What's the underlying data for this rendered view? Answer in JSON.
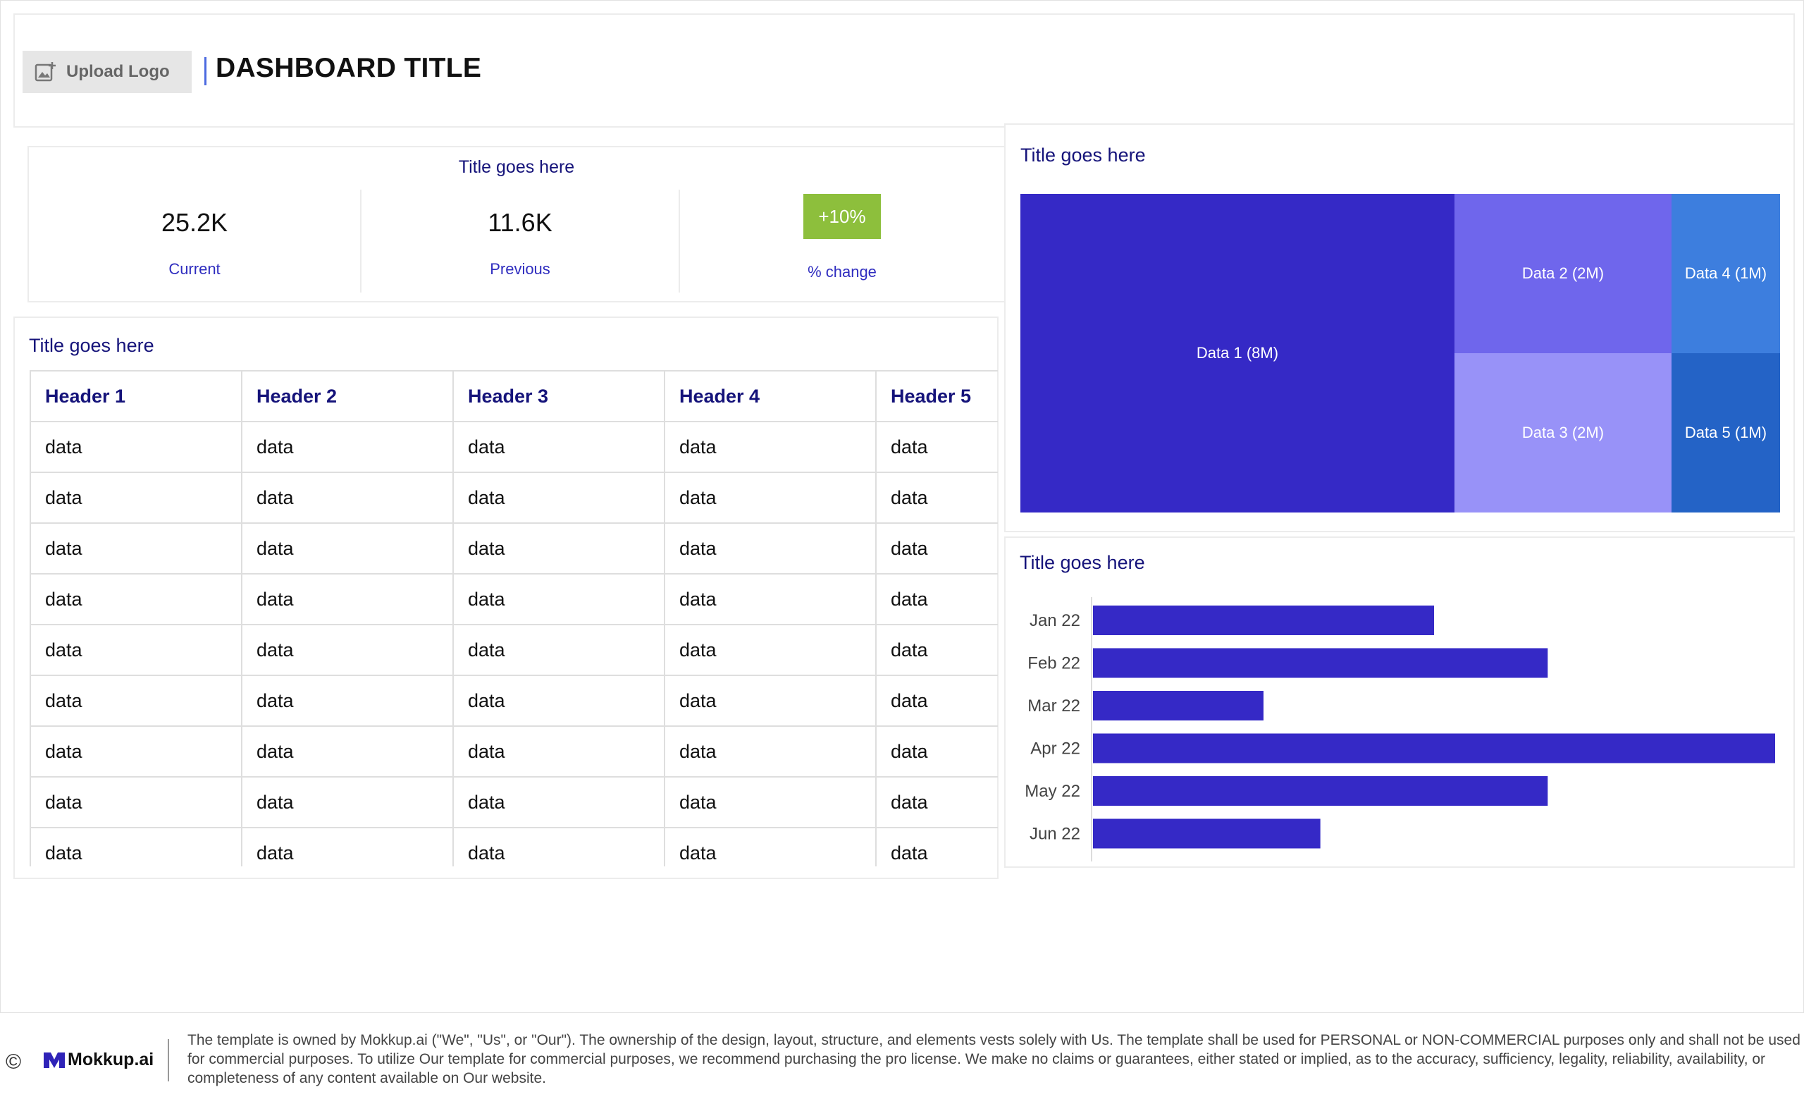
{
  "header": {
    "upload_logo_label": "Upload Logo",
    "title": "DASHBOARD TITLE"
  },
  "kpi": {
    "title": "Title goes here",
    "current": {
      "value": "25.2K",
      "label": "Current"
    },
    "previous": {
      "value": "11.6K",
      "label": "Previous"
    },
    "change": {
      "value": "+10%",
      "label": "% change"
    }
  },
  "table": {
    "title": "Title goes here",
    "headers": [
      "Header 1",
      "Header 2",
      "Header 3",
      "Header 4",
      "Header 5"
    ],
    "rows": [
      [
        "data",
        "data",
        "data",
        "data",
        "data"
      ],
      [
        "data",
        "data",
        "data",
        "data",
        "data"
      ],
      [
        "data",
        "data",
        "data",
        "data",
        "data"
      ],
      [
        "data",
        "data",
        "data",
        "data",
        "data"
      ],
      [
        "data",
        "data",
        "data",
        "data",
        "data"
      ],
      [
        "data",
        "data",
        "data",
        "data",
        "data"
      ],
      [
        "data",
        "data",
        "data",
        "data",
        "data"
      ],
      [
        "data",
        "data",
        "data",
        "data",
        "data"
      ],
      [
        "data",
        "data",
        "data",
        "data",
        "data"
      ]
    ]
  },
  "treemap": {
    "title": "Title goes here",
    "chart_data": {
      "type": "treemap",
      "items": [
        {
          "label": "Data 1 (8M)",
          "value": 8,
          "color": "#3529c6"
        },
        {
          "label": "Data 2 (2M)",
          "value": 2,
          "color": "#6f66ec"
        },
        {
          "label": "Data 3 (2M)",
          "value": 2,
          "color": "#9892f8"
        },
        {
          "label": "Data 4 (1M)",
          "value": 1,
          "color": "#3d7ede"
        },
        {
          "label": "Data 5 (1M)",
          "value": 1,
          "color": "#2463c6"
        }
      ]
    }
  },
  "barchart": {
    "title": "Title goes here",
    "chart_data": {
      "type": "bar",
      "orientation": "horizontal",
      "categories": [
        "Jan 22",
        "Feb 22",
        "Mar 22",
        "Apr 22",
        "May 22",
        "Jun 22"
      ],
      "values": [
        6,
        8,
        3,
        12,
        8,
        4
      ],
      "color": "#3529c6"
    }
  },
  "footer": {
    "brand": "Mokkup.ai",
    "copyright_symbol": "©",
    "text": "The template is owned by Mokkup.ai (\"We\", \"Us\", or \"Our\"). The ownership of the design, layout, structure, and elements vests solely with Us. The template shall be used for PERSONAL or NON-COMMERCIAL purposes only and shall not be used for commercial purposes. To utilize Our template for commercial purposes, we recommend purchasing the pro license. We make no claims or guarantees, either stated or implied, as to the accuracy, sufficiency, legality, reliability, availability, or completeness of any content available on Our website."
  }
}
